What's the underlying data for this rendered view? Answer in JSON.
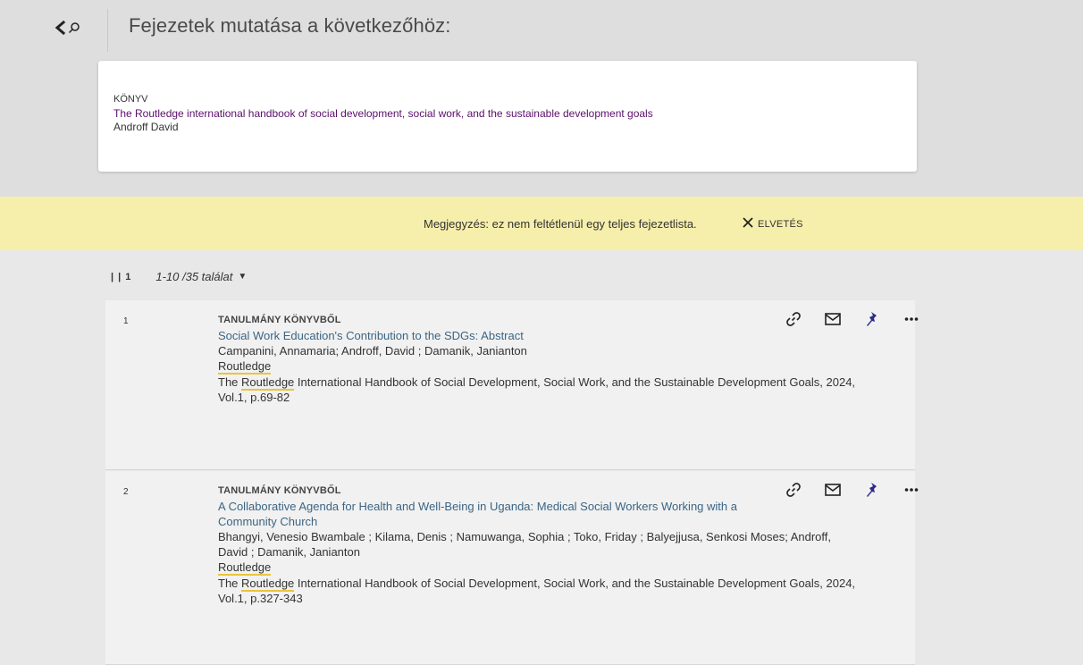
{
  "header": {
    "title": "Fejezetek mutatása a következőhöz:"
  },
  "book": {
    "type": "KÖNYV",
    "title": "The Routledge international handbook of social development, social work, and the sustainable development goals",
    "author": "Androff David"
  },
  "notice": {
    "text": "Megjegyzés: ez nem feltétlenül egy teljes fejezetlista.",
    "dismiss_label": "ELVETÉS"
  },
  "results_bar": {
    "bars": "| |",
    "page": "1",
    "count": "1-10 /35 találat"
  },
  "results": [
    {
      "index": "1",
      "type": "TANULMÁNY KÖNYVBŐL",
      "title": "Social Work Education's Contribution to the SDGs: Abstract",
      "authors": "Campanini, Annamaria; Androff, David ; Damanik, Janianton",
      "publisher": "Routledge",
      "source_prefix": "The ",
      "source_highlight": "Routledge",
      "source_rest": " International Handbook of Social Development, Social Work, and the Sustainable Development Goals, 2024, Vol.1, p.69-82"
    },
    {
      "index": "2",
      "type": "TANULMÁNY KÖNYVBŐL",
      "title": "A Collaborative Agenda for Health and Well-Being in Uganda: Medical Social Workers Working with a Community Church",
      "authors": "Bhangyi, Venesio Bwambale ; Kilama, Denis ; Namuwanga, Sophia ; Toko, Friday ; Balyejjusa, Senkosi Moses; Androff, David ; Damanik, Janianton",
      "publisher": "Routledge",
      "source_prefix": "The ",
      "source_highlight": "Routledge",
      "source_rest": " International Handbook of Social Development, Social Work, and the Sustainable Development Goals, 2024, Vol.1, p.327-343"
    }
  ],
  "icons": {
    "back": "chevron-left-icon",
    "search": "search-icon",
    "close": "close-icon",
    "link": "link-icon",
    "email": "envelope-icon",
    "pin": "pin-icon",
    "more": "more-icon",
    "caret": "caret-down-icon"
  },
  "colors": {
    "book_title": "#5b0f6b",
    "result_title": "#3b6584",
    "pin": "#2c2a8c",
    "notice_bg": "#f6eeab",
    "highlight": "#e9c43c"
  }
}
